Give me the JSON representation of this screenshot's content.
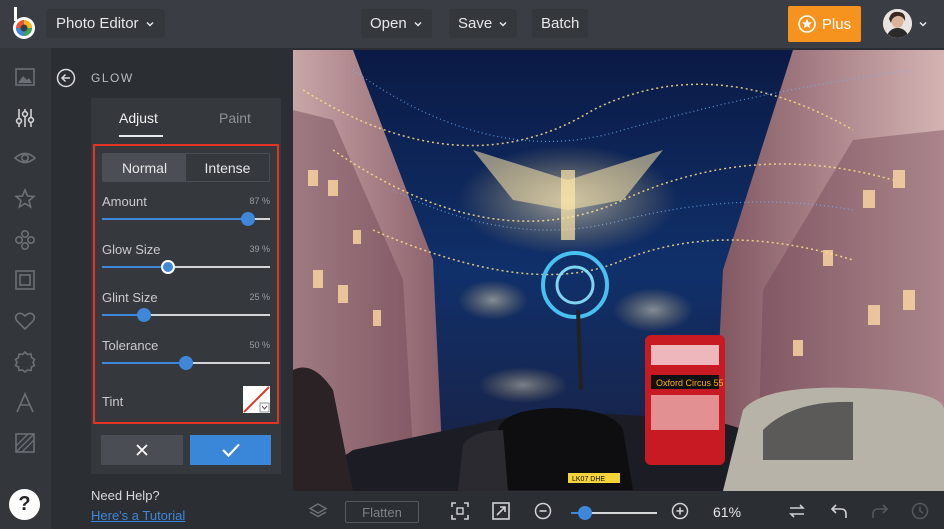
{
  "topbar": {
    "app_menu_label": "Photo Editor",
    "open_label": "Open",
    "save_label": "Save",
    "batch_label": "Batch",
    "plus_label": "Plus"
  },
  "rail": {
    "icons": [
      "image-icon",
      "adjustments-icon",
      "eye-icon",
      "star-icon",
      "flower-icon",
      "frame-icon",
      "heart-icon",
      "badge-icon",
      "text-icon",
      "texture-icon"
    ],
    "help_label": "?"
  },
  "panel": {
    "title": "GLOW",
    "tabs": [
      {
        "label": "Adjust",
        "active": true
      },
      {
        "label": "Paint",
        "active": false
      }
    ],
    "modes": [
      {
        "label": "Normal",
        "active": true
      },
      {
        "label": "Intense",
        "active": false
      }
    ],
    "sliders": [
      {
        "label": "Amount",
        "value_text": "87 %",
        "value": 87
      },
      {
        "label": "Glow Size",
        "value_text": "39 %",
        "value": 39
      },
      {
        "label": "Glint Size",
        "value_text": "25 %",
        "value": 25
      },
      {
        "label": "Tolerance",
        "value_text": "50 %",
        "value": 50
      }
    ],
    "tint_label": "Tint",
    "need_help": "Need Help?",
    "tutorial_link": "Here's a Tutorial"
  },
  "canvas": {
    "bus_sign": "Oxford Circus 55",
    "plate": "LK07 DHE"
  },
  "bottombar": {
    "flatten_label": "Flatten",
    "zoom_text": "61%",
    "zoom_value": 61
  },
  "colors": {
    "accent": "#3f87d9",
    "plus": "#f5931e",
    "highlight_border": "#e33424"
  }
}
